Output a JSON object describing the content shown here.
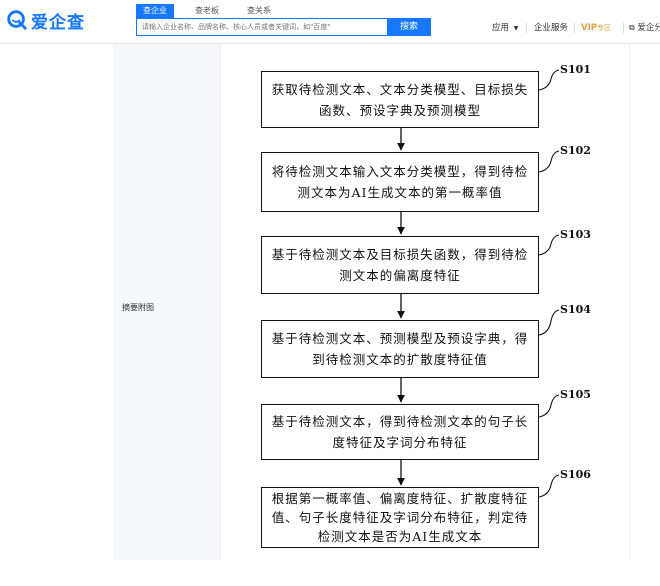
{
  "brand": {
    "name": "爱企查",
    "color": "#1677ff"
  },
  "search": {
    "tabs": [
      {
        "label": "查企业",
        "active": true
      },
      {
        "label": "查老板",
        "active": false
      },
      {
        "label": "查关系",
        "active": false
      }
    ],
    "placeholder": "请输入企业名称、品牌名称、核心人员或者关键词，如\"百度\"",
    "button_label": "搜索"
  },
  "nav": {
    "apps_label": "应用",
    "enterprise_label": "企业服务",
    "vip_label": "VIP",
    "vip_sub_label": "专区",
    "share_label": "爱企分"
  },
  "section": {
    "label": "摘要附图"
  },
  "flowchart": {
    "steps": [
      {
        "id": "S101",
        "text": "获取待检测文本、文本分类模型、目标损失函数、预设字典及预测模型"
      },
      {
        "id": "S102",
        "text": "将待检测文本输入文本分类模型，得到待检测文本为AI生成文本的第一概率值"
      },
      {
        "id": "S103",
        "text": "基于待检测文本及目标损失函数，得到待检测文本的偏离度特征"
      },
      {
        "id": "S104",
        "text": "基于待检测文本、预测模型及预设字典，得到待检测文本的扩散度特征值"
      },
      {
        "id": "S105",
        "text": "基于待检测文本，得到待检测文本的句子长度特征及字词分布特征"
      },
      {
        "id": "S106",
        "text": "根据第一概率值、偏离度特征、扩散度特征值、句子长度特征及字词分布特征，判定待检测文本是否为AI生成文本"
      }
    ]
  }
}
